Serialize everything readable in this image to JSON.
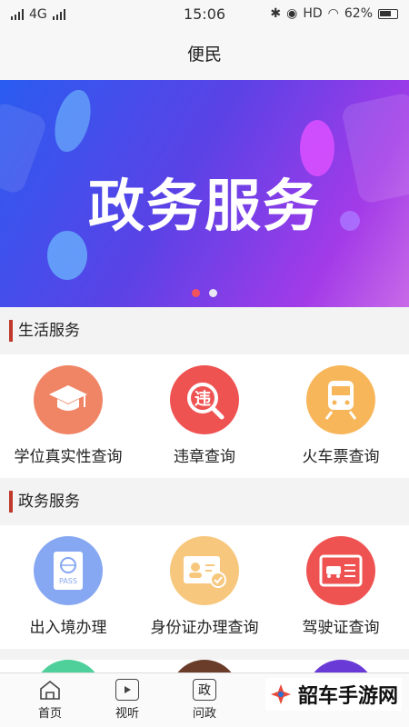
{
  "status_bar": {
    "network": "4G",
    "time": "15:06",
    "hd": "HD",
    "battery": "62%"
  },
  "nav": {
    "title": "便民"
  },
  "banner": {
    "title": "政务服务",
    "slides": 2,
    "active_slide": 0
  },
  "sections": [
    {
      "title": "生活服务",
      "items": [
        {
          "label": "学位真实性查询",
          "icon": "graduation-cap-icon",
          "color": "#f08566"
        },
        {
          "label": "违章查询",
          "icon": "violation-search-icon",
          "color": "#ee5352"
        },
        {
          "label": "火车票查询",
          "icon": "train-icon",
          "color": "#f7b65a"
        }
      ]
    },
    {
      "title": "政务服务",
      "items": [
        {
          "label": "出入境办理",
          "icon": "passport-icon",
          "color": "#86a7f1"
        },
        {
          "label": "身份证办理查询",
          "icon": "id-card-icon",
          "color": "#f7c77d"
        },
        {
          "label": "驾驶证查询",
          "icon": "driver-license-icon",
          "color": "#ee5352"
        }
      ]
    }
  ],
  "partial_row_colors": [
    "#4fd09a",
    "#6a3d2b",
    "#6a3ad6"
  ],
  "tabs": [
    {
      "label": "首页",
      "icon": "home-icon"
    },
    {
      "label": "视听",
      "icon": "tv-icon"
    },
    {
      "label": "问政",
      "icon_text": "政"
    }
  ],
  "watermark": {
    "text": "韶车手游网"
  }
}
